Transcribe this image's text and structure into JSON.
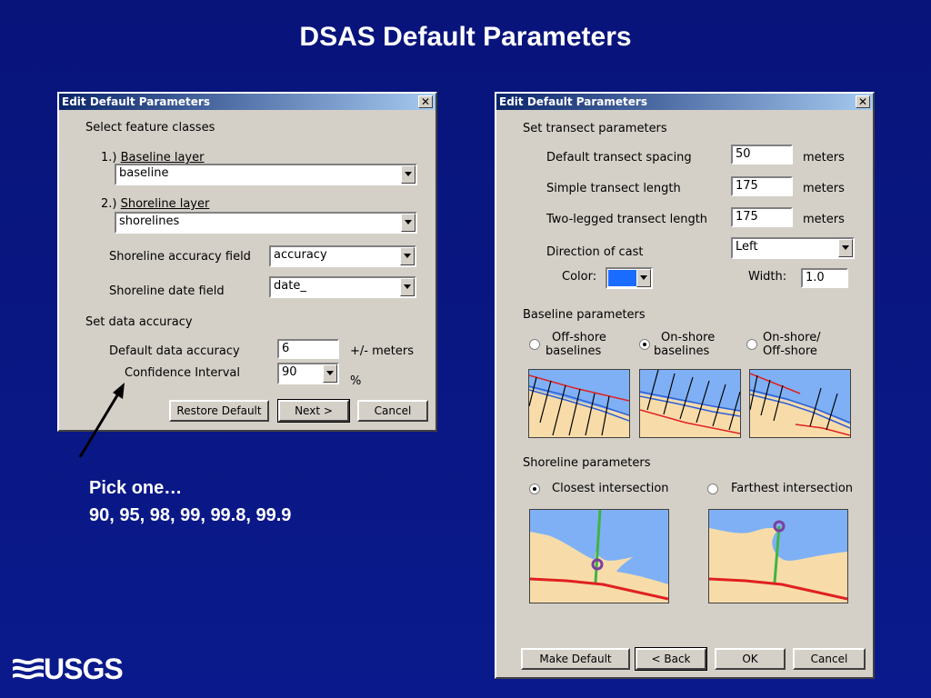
{
  "slide": {
    "title": "DSAS Default Parameters",
    "note_line1": "Pick one…",
    "note_line2": "90, 95, 98, 99, 99.8, 99.9",
    "logo_text": "USGS"
  },
  "dialog1": {
    "title": "Edit Default Parameters",
    "section_features": "Select feature classes",
    "baseline_label_prefix": "1.) ",
    "baseline_label": "Baseline layer",
    "baseline_value": "baseline",
    "shoreline_label_prefix": "2.) ",
    "shoreline_label": "Shoreline layer",
    "shoreline_value": "shorelines",
    "accuracy_field_label": "Shoreline accuracy field",
    "accuracy_field_value": "accuracy",
    "date_field_label": "Shoreline date field",
    "date_field_value": "date_",
    "section_accuracy": "Set data accuracy",
    "default_accuracy_label": "Default data accuracy",
    "default_accuracy_value": "6",
    "accuracy_unit": "+/- meters",
    "confidence_label": "Confidence Interval",
    "confidence_value": "90",
    "confidence_unit": "%",
    "btn_restore": "Restore Default",
    "btn_next": "Next >",
    "btn_cancel": "Cancel"
  },
  "dialog2": {
    "title": "Edit Default Parameters",
    "section_transect": "Set transect parameters",
    "spacing_label": "Default transect spacing",
    "spacing_value": "50",
    "simple_length_label": "Simple transect length",
    "simple_length_value": "175",
    "two_legged_label": "Two-legged transect length",
    "two_legged_value": "175",
    "unit": "meters",
    "direction_label": "Direction of cast",
    "direction_value": "Left",
    "color_label": "Color:",
    "color_value": "#1a6cff",
    "width_label": "Width:",
    "width_value": "1.0",
    "section_baseline": "Baseline parameters",
    "baseline_offshore_l1": "Off-shore",
    "baseline_offshore_l2": "baselines",
    "baseline_onshore_l1": "On-shore",
    "baseline_onshore_l2": "baselines",
    "baseline_both_l1": "On-shore/",
    "baseline_both_l2": "Off-shore",
    "section_shoreline": "Shoreline parameters",
    "closest_label": "Closest intersection",
    "farthest_label": "Farthest intersection",
    "btn_make_default": "Make Default",
    "btn_back": "< Back",
    "btn_ok": "OK",
    "btn_cancel": "Cancel"
  },
  "colors": {
    "slide_bg": "#0a1a8c",
    "water": "#7fb0f5",
    "sand": "#f7dcaa",
    "shoreline_blue": "#2d5fd6",
    "baseline_red": "#e02020",
    "transect_green": "#3fb53f",
    "intersection_purple": "#7b3fa0"
  }
}
